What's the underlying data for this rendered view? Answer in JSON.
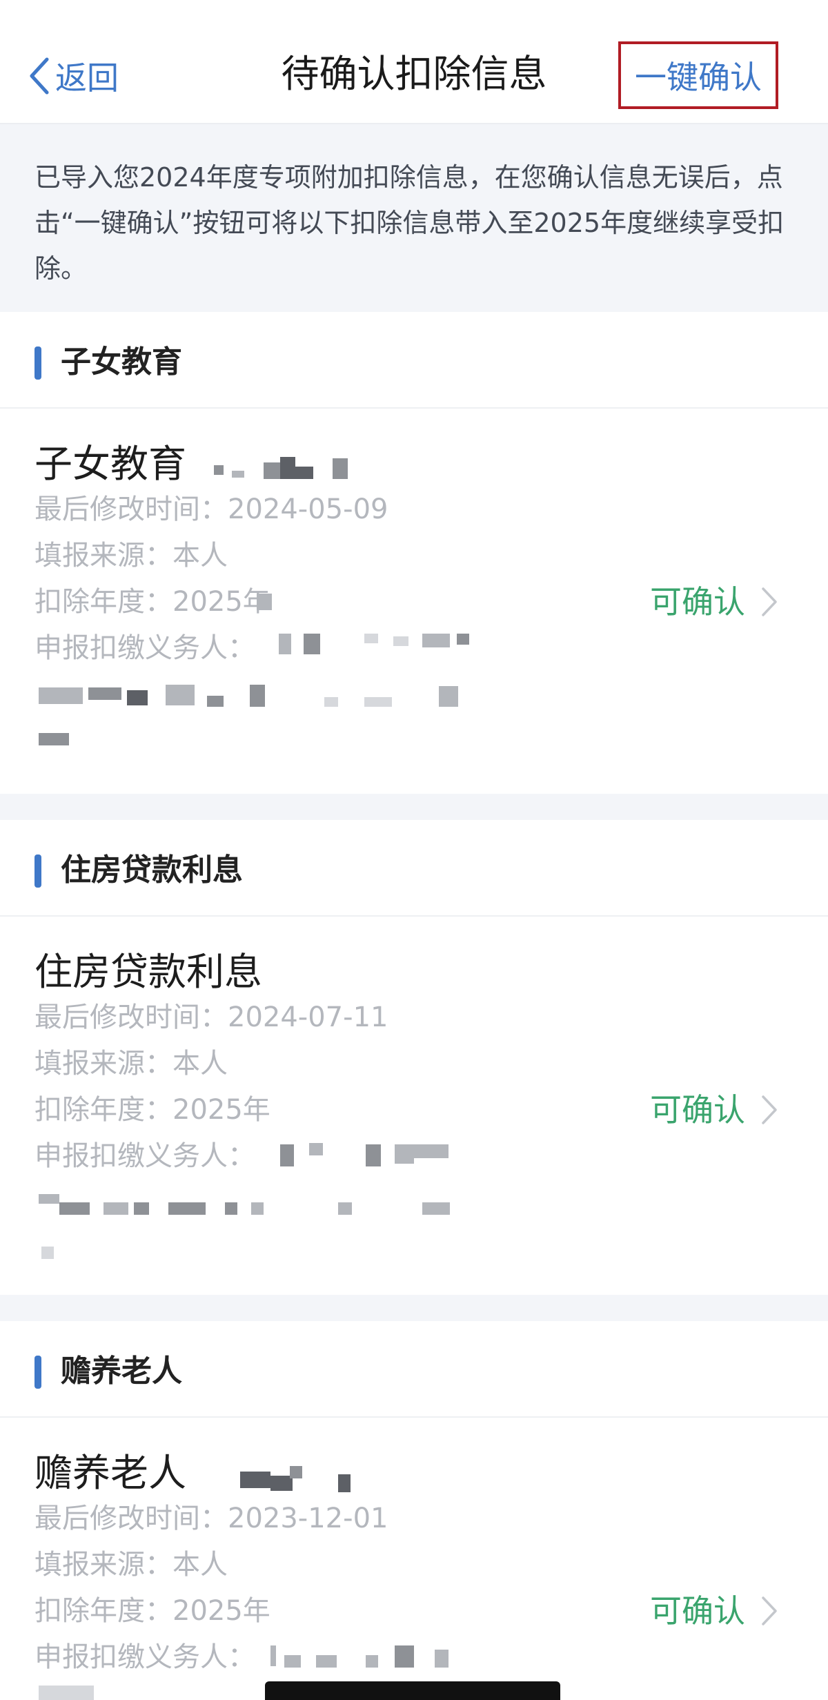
{
  "nav": {
    "back_label": "返回",
    "title": "待确认扣除信息",
    "action_label": "一键确认"
  },
  "notice": {
    "text": "已导入您2024年度专项附加扣除信息，在您确认信息无误后，点击“一键确认”按钮可将以下扣除信息带入至2025年度继续享受扣除。"
  },
  "labels": {
    "modified": "最后修改时间：",
    "source": "填报来源：",
    "year": "扣除年度：",
    "agent": "申报扣缴义务人："
  },
  "sections": [
    {
      "heading": "子女教育",
      "title": "子女教育",
      "modified": "2024-05-09",
      "source": "本人",
      "year": "2025年",
      "status": "可确认"
    },
    {
      "heading": "住房贷款利息",
      "title": "住房贷款利息",
      "modified": "2024-07-11",
      "source": "本人",
      "year": "2025年",
      "status": "可确认"
    },
    {
      "heading": "赡养老人",
      "title": "赡养老人",
      "modified": "2023-12-01",
      "source": "本人",
      "year": "2025年",
      "status": "可确认"
    }
  ],
  "icons": {
    "back": "chevron-left-icon",
    "status_arrow": "chevron-right-icon"
  },
  "colors": {
    "accent": "#3f78c8",
    "status_green": "#3aa46d",
    "highlight_frame": "#b11c24",
    "meta_gray": "#b4b7bd",
    "section_bg": "#f3f5f9"
  }
}
